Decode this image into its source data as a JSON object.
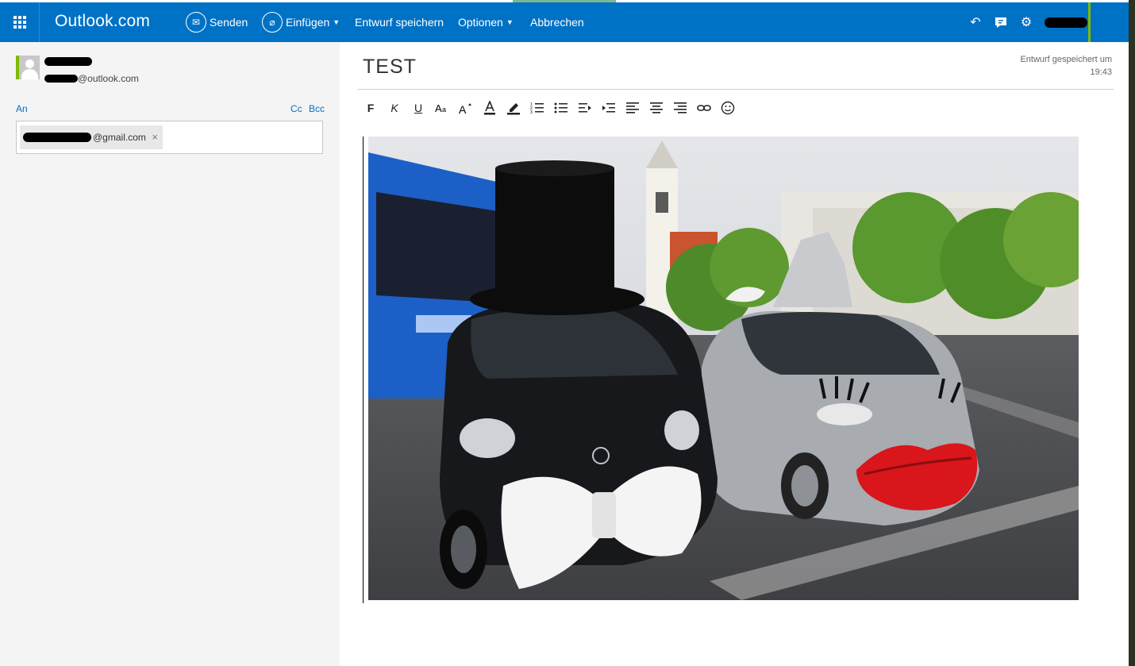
{
  "header": {
    "brand": "Outlook.com",
    "commands": [
      {
        "label": "Senden"
      },
      {
        "label": "Einfügen"
      },
      {
        "label": "Entwurf speichern"
      },
      {
        "label": "Optionen"
      },
      {
        "label": "Abbrechen"
      }
    ],
    "icons": [
      "undo-icon",
      "feedback-icon",
      "gear-icon"
    ],
    "accent": "#0072c6"
  },
  "sender": {
    "email_domain": "@outlook.com"
  },
  "recipients": {
    "to_label": "An",
    "cc_label": "Cc",
    "bcc_label": "Bcc",
    "to_chip_domain": "@gmail.com",
    "remove_glyph": "×"
  },
  "message": {
    "subject": "TEST",
    "saved_line1": "Entwurf gespeichert um",
    "saved_time": "19:43"
  },
  "toolbar": {
    "bold": "F",
    "italic": "K",
    "underline": "U",
    "buttons": [
      "bold-icon",
      "italic-icon",
      "underline-icon",
      "font-size-icon",
      "grow-font-icon",
      "font-color-icon",
      "highlight-icon",
      "numbered-list-icon",
      "bullet-list-icon",
      "decrease-indent-icon",
      "increase-indent-icon",
      "align-left-icon",
      "align-center-icon",
      "align-right-icon",
      "link-icon",
      "emoji-icon"
    ]
  }
}
